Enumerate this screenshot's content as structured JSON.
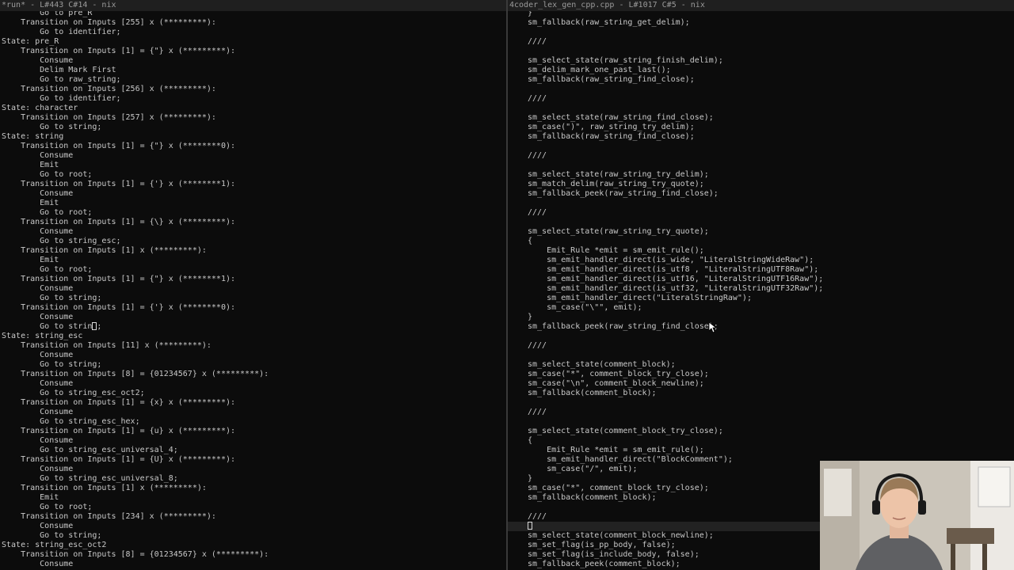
{
  "left_pane": {
    "header": "*run* - L#443 C#14 - nix",
    "partial_line": "        Go to pre_R",
    "lines": [
      "    Transition on Inputs [255] x (*********):",
      "        Go to identifier;",
      "State: pre_R",
      "    Transition on Inputs [1] = {\"} x (*********):",
      "        Consume",
      "        Delim Mark First",
      "        Go to raw_string;",
      "    Transition on Inputs [256] x (*********):",
      "        Go to identifier;",
      "State: character",
      "    Transition on Inputs [257] x (*********):",
      "        Go to string;",
      "State: string",
      "    Transition on Inputs [1] = {\"} x (********0):",
      "        Consume",
      "        Emit",
      "        Go to root;",
      "    Transition on Inputs [1] = {'} x (********1):",
      "        Consume",
      "        Emit",
      "        Go to root;",
      "    Transition on Inputs [1] = {\\} x (*********):",
      "        Consume",
      "        Go to string_esc;",
      "    Transition on Inputs [1] x (*********):",
      "        Emit",
      "        Go to root;",
      "    Transition on Inputs [1] = {\"} x (********1):",
      "        Consume",
      "        Go to string;",
      "    Transition on Inputs [1] = {'} x (********0):",
      "        Consume",
      "        Go to string;",
      "State: string_esc",
      "    Transition on Inputs [11] x (*********):",
      "        Consume",
      "        Go to string;",
      "    Transition on Inputs [8] = {01234567} x (*********):",
      "        Consume",
      "        Go to string_esc_oct2;",
      "    Transition on Inputs [1] = {x} x (*********):",
      "        Consume",
      "        Go to string_esc_hex;",
      "    Transition on Inputs [1] = {u} x (*********):",
      "        Consume",
      "        Go to string_esc_universal_4;",
      "    Transition on Inputs [1] = {U} x (*********):",
      "        Consume",
      "        Go to string_esc_universal_8;",
      "    Transition on Inputs [1] x (*********):",
      "        Emit",
      "        Go to root;",
      "    Transition on Inputs [234] x (*********):",
      "        Consume",
      "        Go to string;",
      "State: string_esc_oct2",
      "    Transition on Inputs [8] = {01234567} x (*********):",
      "        Consume"
    ]
  },
  "right_pane": {
    "header": "4coder_lex_gen_cpp.cpp - L#1017 C#5 - nix",
    "partial_line": "}",
    "lines": [
      "sm_fallback(raw_string_get_delim);",
      "",
      "////",
      "",
      "sm_select_state(raw_string_finish_delim);",
      "sm_delim_mark_one_past_last();",
      "sm_fallback(raw_string_find_close);",
      "",
      "////",
      "",
      "sm_select_state(raw_string_find_close);",
      "sm_case(\")\", raw_string_try_delim);",
      "sm_fallback(raw_string_find_close);",
      "",
      "////",
      "",
      "sm_select_state(raw_string_try_delim);",
      "sm_match_delim(raw_string_try_quote);",
      "sm_fallback_peek(raw_string_find_close);",
      "",
      "////",
      "",
      "sm_select_state(raw_string_try_quote);",
      "{",
      "    Emit_Rule *emit = sm_emit_rule();",
      "    sm_emit_handler_direct(is_wide, \"LiteralStringWideRaw\");",
      "    sm_emit_handler_direct(is_utf8 , \"LiteralStringUTF8Raw\");",
      "    sm_emit_handler_direct(is_utf16, \"LiteralStringUTF16Raw\");",
      "    sm_emit_handler_direct(is_utf32, \"LiteralStringUTF32Raw\");",
      "    sm_emit_handler_direct(\"LiteralStringRaw\");",
      "    sm_case(\"\\\"\", emit);",
      "}",
      "sm_fallback_peek(raw_string_find_close);",
      "",
      "////",
      "",
      "sm_select_state(comment_block);",
      "sm_case(\"*\", comment_block_try_close);",
      "sm_case(\"\\n\", comment_block_newline);",
      "sm_fallback(comment_block);",
      "",
      "////",
      "",
      "sm_select_state(comment_block_try_close);",
      "{",
      "    Emit_Rule *emit = sm_emit_rule();",
      "    sm_emit_handler_direct(\"BlockComment\");",
      "    sm_case(\"/\", emit);",
      "}",
      "sm_case(\"*\", comment_block_try_close);",
      "sm_fallback(comment_block);",
      "",
      "////",
      "",
      "sm_select_state(comment_block_newline);",
      "sm_set_flag(is_pp_body, false);",
      "sm_set_flag(is_include_body, false);",
      "sm_fallback_peek(comment_block);"
    ]
  }
}
